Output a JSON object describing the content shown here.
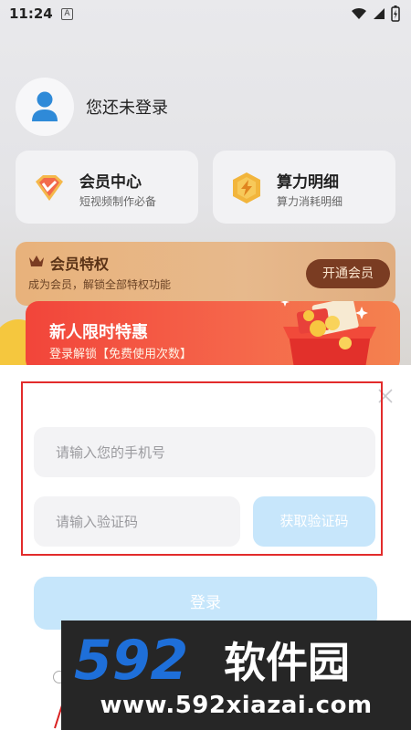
{
  "statusbar": {
    "time": "11:24",
    "badge": "A"
  },
  "user": {
    "name": "您还未登录"
  },
  "cards": {
    "vip": {
      "title": "会员中心",
      "subtitle": "短视频制作必备"
    },
    "power": {
      "title": "算力明细",
      "subtitle": "算力消耗明细"
    }
  },
  "privilege": {
    "title": "会员特权",
    "subtitle": "成为会员，解锁全部特权功能",
    "button": "开通会员"
  },
  "promo": {
    "title": "新人限时特惠",
    "subtitle": "登录解锁【免费使用次数】"
  },
  "login": {
    "phone_placeholder": "请输入您的手机号",
    "code_placeholder": "请输入验证码",
    "get_code": "获取验证码",
    "submit": "登录"
  },
  "watermark": {
    "logo": "592软件园",
    "url": "www.592xiazai.com"
  },
  "colors": {
    "accent_blue": "#c6e6fb",
    "promo_red": "#f2453a",
    "highlight_frame": "#e22b2b"
  }
}
